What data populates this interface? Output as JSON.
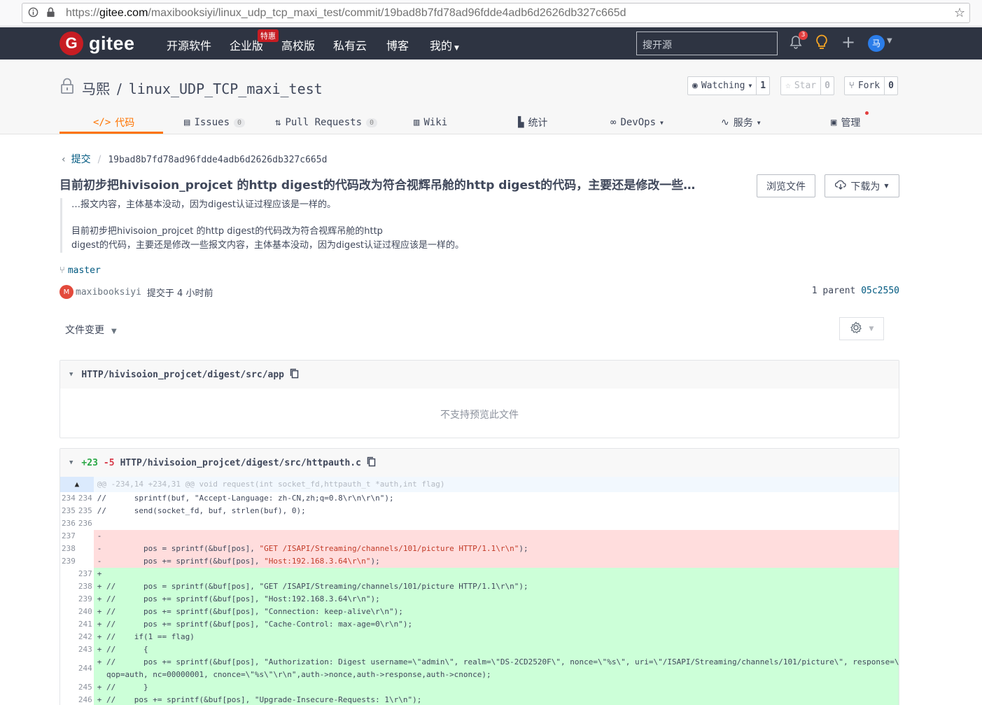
{
  "browser": {
    "url_prefix": "https://",
    "url_domain": "gitee.com",
    "url_path": "/maxibooksiyi/linux_udp_tcp_maxi_test/commit/19bad8b7fd78ad96fdde4adb6d2626db327c665d"
  },
  "header": {
    "logo_text": "gitee",
    "nav": [
      "开源软件",
      "企业版",
      "高校版",
      "私有云",
      "博客",
      "我的"
    ],
    "enterprise_badge": "特惠",
    "search_placeholder": "搜开源",
    "notification_count": "3",
    "avatar_char": "马"
  },
  "repo": {
    "owner": "马熙",
    "name": "linux_UDP_TCP_maxi_test",
    "watch_label": "Watching",
    "watch_count": "1",
    "star_label": "Star",
    "star_count": "0",
    "fork_label": "Fork",
    "fork_count": "0",
    "tabs": [
      {
        "label": "代码"
      },
      {
        "label": "Issues",
        "count": "0"
      },
      {
        "label": "Pull Requests",
        "count": "0"
      },
      {
        "label": "Wiki"
      },
      {
        "label": "统计"
      },
      {
        "label": "DevOps"
      },
      {
        "label": "服务"
      },
      {
        "label": "管理"
      }
    ]
  },
  "commit": {
    "breadcrumb_link": "提交",
    "hash": "19bad8b7fd78ad96fdde4adb6d2626db327c665d",
    "title": "目前初步把hivisoion_projcet 的http digest的代码改为符合视辉吊舱的http digest的代码，主要还是修改一些…",
    "body_1": "…报文内容，主体基本没动，因为digest认证过程应该是一样的。",
    "body_2a": "目前初步把hivisoion_projcet 的http digest的代码改为符合视辉吊舱的http",
    "body_2b": "digest的代码，主要还是修改一些报文内容，主体基本没动，因为digest认证过程应该是一样的。",
    "browse_button": "浏览文件",
    "download_button": "下载为",
    "branch": "master",
    "author": "maxibooksiyi",
    "author_initial": "M",
    "committed_text": "提交于 4 小时前",
    "parent_label": "1 parent",
    "parent_hash": "05c2550"
  },
  "files_header": {
    "label": "文件变更"
  },
  "files": [
    {
      "path": "HTTP/hivisoion_projcet/digest/src/app",
      "message": "不支持预览此文件"
    },
    {
      "additions": "+23",
      "deletions": "-5",
      "path": "HTTP/hivisoion_projcet/digest/src/httpauth.c",
      "hunk": "@@ -234,14 +234,31 @@ void request(int socket_fd,httpauth_t *auth,int flag)",
      "lines": [
        {
          "type": "ctx",
          "old": "234",
          "new": "234",
          "code": "//      sprintf(buf, \"Accept-Language: zh-CN,zh;q=0.8\\r\\n\\r\\n\");"
        },
        {
          "type": "ctx",
          "old": "235",
          "new": "235",
          "code": "//      send(socket_fd, buf, strlen(buf), 0);"
        },
        {
          "type": "ctx",
          "old": "236",
          "new": "236",
          "code": ""
        },
        {
          "type": "del",
          "old": "237",
          "new": "",
          "code": "-"
        },
        {
          "type": "del",
          "old": "238",
          "new": "",
          "code": "-         pos = sprintf(&buf[pos], ",
          "str": "\"GET /ISAPI/Streaming/channels/101/picture HTTP/1.1\\r\\n\"",
          "tail": ");"
        },
        {
          "type": "del",
          "old": "239",
          "new": "",
          "code": "-         pos += sprintf(&buf[pos], ",
          "str": "\"Host:192.168.3.64\\r\\n\"",
          "tail": ");"
        },
        {
          "type": "add",
          "old": "",
          "new": "237",
          "code": "+"
        },
        {
          "type": "add",
          "old": "",
          "new": "238",
          "code": "+ //      pos = sprintf(&buf[pos], \"GET /ISAPI/Streaming/channels/101/picture HTTP/1.1\\r\\n\");"
        },
        {
          "type": "add",
          "old": "",
          "new": "239",
          "code": "+ //      pos += sprintf(&buf[pos], \"Host:192.168.3.64\\r\\n\");"
        },
        {
          "type": "add",
          "old": "",
          "new": "240",
          "code": "+ //      pos += sprintf(&buf[pos], \"Connection: keep-alive\\r\\n\");"
        },
        {
          "type": "add",
          "old": "",
          "new": "241",
          "code": "+ //      pos += sprintf(&buf[pos], \"Cache-Control: max-age=0\\r\\n\");"
        },
        {
          "type": "add",
          "old": "",
          "new": "242",
          "code": "+ //    if(1 == flag)"
        },
        {
          "type": "add",
          "old": "",
          "new": "243",
          "code": "+ //      {"
        },
        {
          "type": "add-tall",
          "old": "",
          "new": "244",
          "code": "+ //      pos += sprintf(&buf[pos], \"Authorization: Digest username=\\\"admin\\\", realm=\\\"DS-2CD2520F\\\", nonce=\\\"%s\\\", uri=\\\"/ISAPI/Streaming/channels/101/picture\\\", response=\\\"%s\\\",",
          "code2": "  qop=auth, nc=00000001, cnonce=\\\"%s\\\"\\r\\n\",auth->nonce,auth->response,auth->cnonce);"
        },
        {
          "type": "add",
          "old": "",
          "new": "245",
          "code": "+ //      }"
        },
        {
          "type": "add",
          "old": "",
          "new": "246",
          "code": "+ //    pos += sprintf(&buf[pos], \"Upgrade-Insecure-Requests: 1\\r\\n\");"
        }
      ]
    }
  ],
  "colors": {
    "header_bg": "#2e3442",
    "accent": "#fe7300",
    "brand_red": "#c71d23",
    "link": "#005980",
    "added_bg": "#ccffd8",
    "deleted_bg": "#ffdddd"
  }
}
